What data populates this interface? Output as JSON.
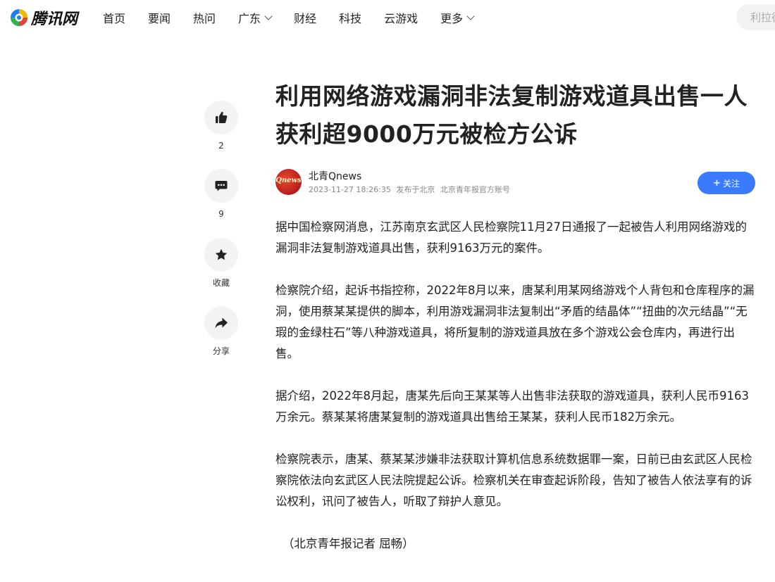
{
  "header": {
    "logo_text": "腾讯网",
    "nav": [
      {
        "label": "首页",
        "dropdown": false
      },
      {
        "label": "要闻",
        "dropdown": false
      },
      {
        "label": "热问",
        "dropdown": false
      },
      {
        "label": "广东",
        "dropdown": true
      },
      {
        "label": "财经",
        "dropdown": false
      },
      {
        "label": "科技",
        "dropdown": false
      },
      {
        "label": "云游戏",
        "dropdown": false
      },
      {
        "label": "更多",
        "dropdown": true
      }
    ],
    "search_placeholder": "利拉德"
  },
  "rail": {
    "like_count": "2",
    "comment_count": "9",
    "favorite_label": "收藏",
    "share_label": "分享"
  },
  "article": {
    "title": "利用网络游戏漏洞非法复制游戏道具出售一人获利超9000万元被检方公诉",
    "author": {
      "avatar_text": "Qnews",
      "name": "北青Qnews",
      "datetime": "2023-11-27 18:26:35",
      "location": "发布于北京",
      "account": "北京青年报官方账号"
    },
    "follow_label": "关注",
    "paragraphs": [
      "据中国检察网消息，江苏南京玄武区人民检察院11月27日通报了一起被告人利用网络游戏的漏洞非法复制游戏道具出售，获利9163万元的案件。",
      "检察院介绍，起诉书指控称，2022年8月以来，唐某利用某网络游戏个人背包和仓库程序的漏洞，使用蔡某某提供的脚本，利用游戏漏洞非法复制出“矛盾的结晶体”“扭曲的次元结晶”“无瑕的金绿柱石”等八种游戏道具，将所复制的游戏道具放在多个游戏公会仓库内，再进行出售。",
      "据介绍，2022年8月起，唐某先后向王某某等人出售非法获取的游戏道具，获利人民币9163万余元。蔡某某将唐某复制的游戏道具出售给王某某，获利人民币182万余元。",
      "检察院表示，唐某、蔡某某涉嫌非法获取计算机信息系统数据罪一案，日前已由玄武区人民检察院依法向玄武区人民法院提起公诉。检察机关在审查起诉阶段，告知了被告人依法享有的诉讼权利，讯问了被告人，听取了辩护人意见。"
    ],
    "signature": "（北京青年报记者 屈畅）"
  },
  "colors": {
    "accent": "#3a7afe",
    "rail_bg": "#f3f3f3",
    "meta_text": "#888888"
  }
}
